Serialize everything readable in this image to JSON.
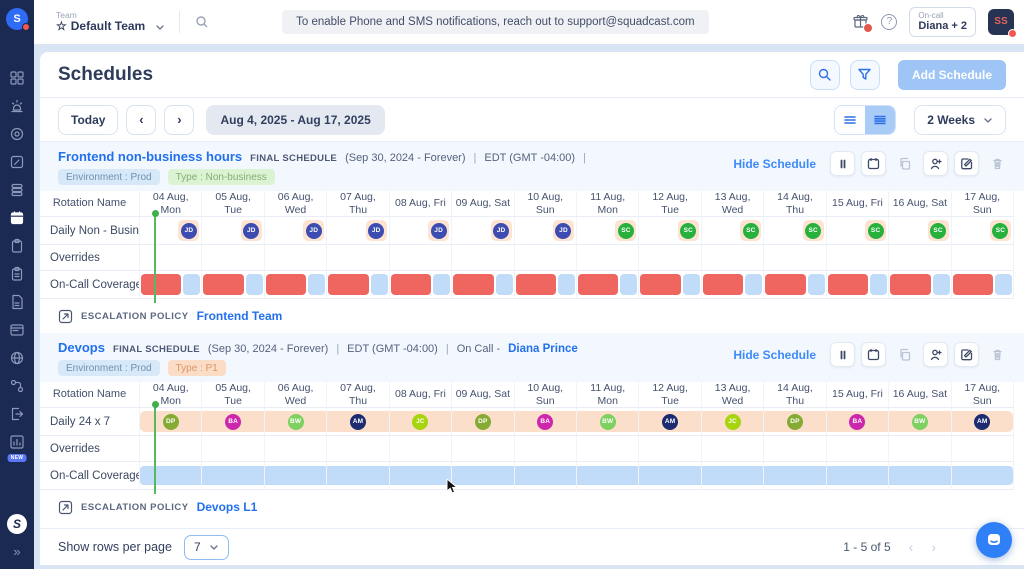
{
  "sidebar": {
    "logo_initial": "S",
    "new_badge": "NEW",
    "expand_glyph": "»"
  },
  "topbar": {
    "team_label": "Team",
    "team_star": "☆",
    "team_name": "Default Team",
    "banner": "To enable Phone and SMS notifications, reach out to support@squadcast.com",
    "oncall_label": "On-call",
    "oncall_value": "Diana + 2",
    "avatar_initials": "SS"
  },
  "page": {
    "title": "Schedules",
    "add_button": "Add Schedule"
  },
  "toolbar": {
    "today": "Today",
    "prev": "‹",
    "next": "›",
    "range": "Aug 4, 2025 - Aug 17, 2025",
    "period": "2 Weeks"
  },
  "table": {
    "rotation_header": "Rotation Name",
    "days": [
      "04 Aug, Mon",
      "05 Aug, Tue",
      "06 Aug, Wed",
      "07 Aug, Thu",
      "08 Aug, Fri",
      "09 Aug, Sat",
      "10 Aug, Sun",
      "11 Aug, Mon",
      "12 Aug, Tue",
      "13 Aug, Wed",
      "14 Aug, Thu",
      "15 Aug, Fri",
      "16 Aug, Sat",
      "17 Aug, Sun"
    ]
  },
  "schedules": [
    {
      "title": "Frontend non-business hours",
      "badge": "FINAL SCHEDULE",
      "period": "(Sep 30, 2024 - Forever)",
      "sep1": "|",
      "timezone": "EDT (GMT -04:00)",
      "sep2": "|",
      "oncall_prefix": "",
      "oncall_name": "",
      "tags": [
        {
          "label": "Environment : Prod",
          "bg": "#d7e8f8",
          "fg": "#7191ae"
        },
        {
          "label": "Type : Non-business",
          "bg": "#dcf3d3",
          "fg": "#83ac72"
        }
      ],
      "hide_label": "Hide Schedule",
      "rotation_label": "Daily Non - Business...",
      "overrides_label": "Overrides",
      "coverage_label": "On-Call Coverage",
      "escalation_label": "ESCALATION POLICY",
      "escalation_policy": "Frontend Team",
      "shift_style": "chips",
      "shifts": [
        {
          "initials": "JD",
          "color": "#3d4cb0"
        },
        {
          "initials": "JD",
          "color": "#3d4cb0"
        },
        {
          "initials": "JD",
          "color": "#3d4cb0"
        },
        {
          "initials": "JD",
          "color": "#3d4cb0"
        },
        {
          "initials": "JD",
          "color": "#3d4cb0"
        },
        {
          "initials": "JD",
          "color": "#3d4cb0"
        },
        {
          "initials": "JD",
          "color": "#3d4cb0"
        },
        {
          "initials": "SC",
          "color": "#27b13c"
        },
        {
          "initials": "SC",
          "color": "#27b13c"
        },
        {
          "initials": "SC",
          "color": "#27b13c"
        },
        {
          "initials": "SC",
          "color": "#27b13c"
        },
        {
          "initials": "SC",
          "color": "#27b13c"
        },
        {
          "initials": "SC",
          "color": "#27b13c"
        },
        {
          "initials": "SC",
          "color": "#27b13c"
        }
      ],
      "coverage": {
        "style": "split",
        "busy_color": "#ef6660",
        "free_color": "#c1dcf8"
      }
    },
    {
      "title": "Devops",
      "badge": "FINAL SCHEDULE",
      "period": "(Sep 30, 2024 - Forever)",
      "sep1": "|",
      "timezone": "EDT (GMT -04:00)",
      "sep2": "|",
      "oncall_prefix": "On Call -",
      "oncall_name": "Diana Prince",
      "tags": [
        {
          "label": "Environment : Prod",
          "bg": "#d7e8f8",
          "fg": "#7191ae"
        },
        {
          "label": "Type : P1",
          "bg": "#fbddc6",
          "fg": "#da9468"
        }
      ],
      "hide_label": "Hide Schedule",
      "rotation_label": "Daily 24 x 7",
      "overrides_label": "Overrides",
      "coverage_label": "On-Call Coverage",
      "escalation_label": "ESCALATION POLICY",
      "escalation_policy": "Devops L1",
      "shift_style": "band",
      "band_color": "#fbdfcb",
      "shifts": [
        {
          "initials": "DP",
          "color": "#85ab33"
        },
        {
          "initials": "BA",
          "color": "#cc27ad"
        },
        {
          "initials": "BW",
          "color": "#7ed161"
        },
        {
          "initials": "AM",
          "color": "#1d2b70"
        },
        {
          "initials": "JC",
          "color": "#a6d40e"
        },
        {
          "initials": "DP",
          "color": "#85ab33"
        },
        {
          "initials": "BA",
          "color": "#cc27ad"
        },
        {
          "initials": "BW",
          "color": "#7ed161"
        },
        {
          "initials": "AM",
          "color": "#1d2b70"
        },
        {
          "initials": "JC",
          "color": "#a6d40e"
        },
        {
          "initials": "DP",
          "color": "#85ab33"
        },
        {
          "initials": "BA",
          "color": "#cc27ad"
        },
        {
          "initials": "BW",
          "color": "#7ed161"
        },
        {
          "initials": "AM",
          "color": "#1d2b70"
        }
      ],
      "coverage": {
        "style": "full",
        "color": "#c1dcf8"
      }
    }
  ],
  "footer": {
    "rows_label": "Show rows per page",
    "rows_value": "7",
    "range": "1 - 5 of 5",
    "prev": "‹",
    "next": "›"
  }
}
